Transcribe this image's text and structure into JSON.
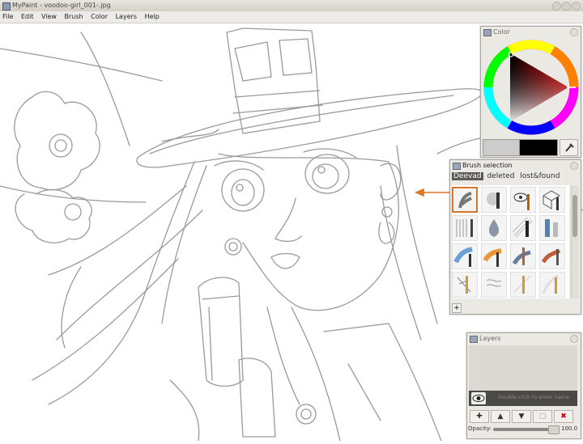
{
  "window": {
    "title": "MyPaint - voodoo-girl_001-.jpg"
  },
  "menu": [
    "File",
    "Edit",
    "View",
    "Brush",
    "Color",
    "Layers",
    "Help"
  ],
  "colors": {
    "accent_orange": "#d9762a",
    "fg_color": "#000000",
    "bg_color": "#cccccc"
  },
  "color_panel": {
    "title": "Color"
  },
  "brush_panel": {
    "title": "Brush selection",
    "tabs": [
      {
        "label": "Deevad",
        "active": true
      },
      {
        "label": "deleted",
        "active": false
      },
      {
        "label": "lost&found",
        "active": false
      }
    ],
    "add_label": "+"
  },
  "layers_panel": {
    "title": "Layers",
    "layer_name_placeholder": "Double click to enter name",
    "buttons": [
      "add-layer",
      "move-layer-up",
      "move-layer-down",
      "duplicate-layer",
      "delete-layer"
    ],
    "opacity_label": "Opacity:",
    "opacity_value": "100.0"
  }
}
